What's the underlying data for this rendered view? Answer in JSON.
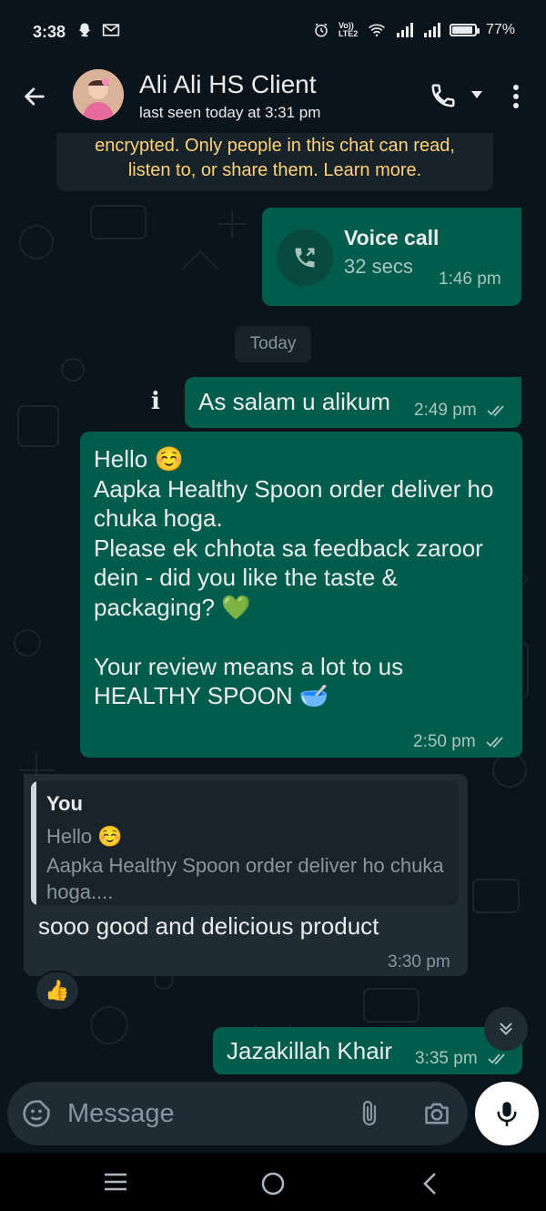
{
  "status_bar": {
    "time": "3:38",
    "network_label": "Vo)) LTE2",
    "battery": "77%",
    "icons": [
      "snapchat-icon",
      "gmail-icon",
      "alarm-icon",
      "volte-icon",
      "wifi-icon",
      "signal-icon",
      "signal-icon",
      "battery-icon"
    ]
  },
  "header": {
    "contact_name": "Ali Ali HS Client",
    "last_seen": "last seen today at 3:31 pm",
    "icons": [
      "back-arrow-icon",
      "avatar",
      "phone-icon",
      "dropdown-icon",
      "more-vert-icon"
    ]
  },
  "encryption_notice": {
    "line1": "encrypted. Only people in this chat can read,",
    "line2": "listen to, or share them. Learn more."
  },
  "messages": {
    "voice_call": {
      "title": "Voice call",
      "duration": "32 secs",
      "time": "1:46 pm"
    },
    "date_divider": "Today",
    "salam": {
      "text": "As salam u alikum",
      "time": "2:49 pm"
    },
    "hello": {
      "text": "Hello ☺️\nAapka Healthy Spoon order deliver ho chuka hoga.\nPlease ek chhota sa feedback zaroor dein - did you like the taste & packaging? 💚\n\nYour review means a lot to us\nHEALTHY SPOON 🥣",
      "time": "2:50 pm"
    },
    "reply": {
      "quote_author": "You",
      "quote_line1": "Hello ☺️",
      "quote_line2": "Aapka Healthy Spoon order deliver ho chuka hoga....",
      "text": "sooo good and delicious product",
      "time": "3:30 pm",
      "reaction": "👍"
    },
    "jazakallah": {
      "text": "Jazakillah Khair",
      "time": "3:35 pm"
    }
  },
  "composer": {
    "placeholder": "Message"
  },
  "colors": {
    "background": "#0b141a",
    "outgoing_bubble": "#005c4b",
    "incoming_bubble": "#202c33",
    "encryption_text": "#ffd279",
    "read_ticks": "#a8c6bf"
  }
}
